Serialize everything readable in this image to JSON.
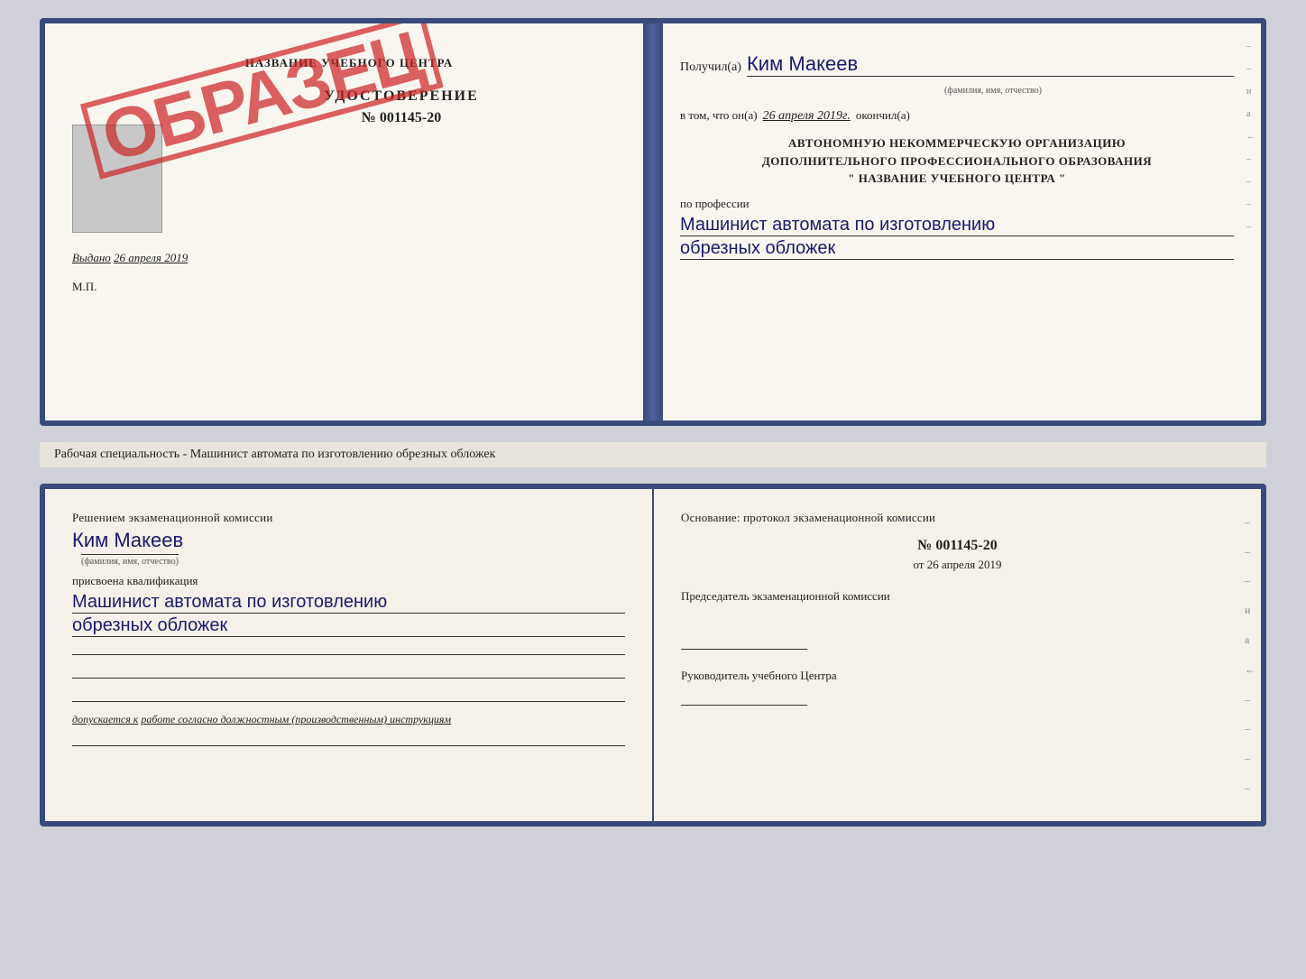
{
  "top_doc": {
    "left": {
      "header": "НАЗВАНИЕ УЧЕБНОГО ЦЕНТРА",
      "cert_title": "УДОСТОВЕРЕНИЕ",
      "cert_number": "№ 001145-20",
      "issued_label": "Выдано",
      "issued_date": "26 апреля 2019",
      "mp_label": "М.П.",
      "stamp_text": "ОБРАЗЕЦ"
    },
    "right": {
      "received_label": "Получил(а)",
      "recipient_name": "Ким Макеев",
      "fio_label": "(фамилия, имя, отчество)",
      "in_that_label": "в том, что он(а)",
      "completion_date": "26 апреля 2019г.",
      "finished_label": "окончил(а)",
      "org_line1": "АВТОНОМНУЮ НЕКОММЕРЧЕСКУЮ ОРГАНИЗАЦИЮ",
      "org_line2": "ДОПОЛНИТЕЛЬНОГО ПРОФЕССИОНАЛЬНОГО ОБРАЗОВАНИЯ",
      "org_line3": "\"   НАЗВАНИЕ УЧЕБНОГО ЦЕНТРА   \"",
      "profession_label": "по профессии",
      "profession_line1": "Машинист автомата по изготовлению",
      "profession_line2": "обрезных обложек"
    }
  },
  "subtitle": "Рабочая специальность - Машинист автомата по изготовлению обрезных обложек",
  "bottom_doc": {
    "left": {
      "decision_label": "Решением экзаменационной комиссии",
      "person_name": "Ким Макеев",
      "fio_sub": "(фамилия, имя, отчество)",
      "qualification_label": "присвоена квалификация",
      "qualification_line1": "Машинист автомата по изготовлению",
      "qualification_line2": "обрезных обложек",
      "допускается_prefix": "допускается к",
      "допускается_text": "работе согласно должностным (производственным) инструкциям"
    },
    "right": {
      "basis_label": "Основание: протокол экзаменационной комиссии",
      "protocol_number": "№ 001145-20",
      "protocol_date_prefix": "от",
      "protocol_date": "26 апреля 2019",
      "chairman_label": "Председатель экзаменационной комиссии",
      "director_label": "Руководитель учебного Центра"
    }
  }
}
